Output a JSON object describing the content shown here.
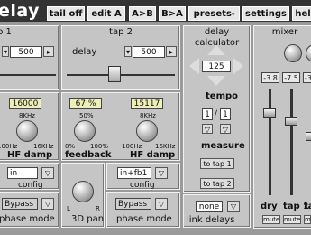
{
  "app": {
    "title_fragment": "elay"
  },
  "menu": [
    {
      "label": "tail off"
    },
    {
      "label": "edit A"
    },
    {
      "label": "A>B"
    },
    {
      "label": "B>A"
    },
    {
      "label": "presets"
    },
    {
      "label": "settings"
    },
    {
      "label": "hel"
    }
  ],
  "tap1": {
    "title": "p 1",
    "delay_value": "500",
    "hf_value": "16000",
    "hf_scale_top": "8KHz",
    "hf_scale_left": "100Hz",
    "hf_scale_right": "16KHz",
    "hf_label": "HF damp",
    "config_value": "in",
    "config_label": "config",
    "phase_value": "Bypass",
    "phase_label": "phase mode"
  },
  "tap2": {
    "title": "tap 2",
    "delay_label": "delay",
    "delay_value": "500",
    "feedback_value": "67 %",
    "feedback_scale_top": "50%",
    "feedback_scale_left": "0%",
    "feedback_scale_right": "100%",
    "feedback_label": "feedback",
    "hf_value": "15117",
    "hf_scale_top": "8KHz",
    "hf_scale_left": "100Hz",
    "hf_scale_right": "16KHz",
    "hf_label": "HF damp",
    "pan_label": "3D pan",
    "pan_left": "L",
    "pan_right": "R",
    "config_value": "in+fb1",
    "config_label": "config",
    "phase_value": "Bypass",
    "phase_label": "phase mode"
  },
  "calc": {
    "title": "delay calculator",
    "tempo_value": "125",
    "tempo_label": "tempo",
    "measure_num": "1",
    "measure_sep": "/",
    "measure_den": "1",
    "measure_label": "measure",
    "to_tap1": "to tap 1",
    "to_tap2": "to tap 2"
  },
  "link": {
    "value": "none",
    "label": "link delays"
  },
  "mixer": {
    "title": "mixer",
    "values": [
      "-3.8",
      "-7.5",
      "-3"
    ],
    "channels": [
      {
        "label": "dry",
        "mute": "mute"
      },
      {
        "label": "tap 1",
        "mute": "mute"
      },
      {
        "label": "ta",
        "mute": "mute"
      }
    ]
  }
}
